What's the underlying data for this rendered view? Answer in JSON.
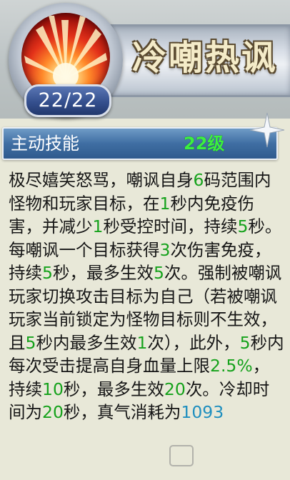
{
  "skill": {
    "name": "冷嘲热讽",
    "charges": "22/22",
    "type_label": "主动技能",
    "level": "22级"
  },
  "description": [
    {
      "t": "极尽嬉笑怒骂，嘲讽自身",
      "c": ""
    },
    {
      "t": "6",
      "c": "hl"
    },
    {
      "t": "码范围内怪物和玩家目标，在",
      "c": ""
    },
    {
      "t": "1",
      "c": "hl"
    },
    {
      "t": "秒内免疫伤害，并减少",
      "c": ""
    },
    {
      "t": "1",
      "c": "hl"
    },
    {
      "t": "秒受控时间，持续",
      "c": ""
    },
    {
      "t": "5",
      "c": "hl"
    },
    {
      "t": "秒。每嘲讽一个目标获得",
      "c": ""
    },
    {
      "t": "3",
      "c": "hl"
    },
    {
      "t": "次伤害免疫，持续",
      "c": ""
    },
    {
      "t": "5",
      "c": "hl"
    },
    {
      "t": "秒，最多生效",
      "c": ""
    },
    {
      "t": "5",
      "c": "hl"
    },
    {
      "t": "次。强制被嘲讽玩家切换攻击目标为自己（若被嘲讽玩家当前锁定为怪物目标则不生效，且",
      "c": ""
    },
    {
      "t": "5",
      "c": "hl"
    },
    {
      "t": "秒内最多生效",
      "c": ""
    },
    {
      "t": "1",
      "c": "hl"
    },
    {
      "t": "次），此外，",
      "c": ""
    },
    {
      "t": "5",
      "c": "hl"
    },
    {
      "t": "秒内每次受击提高自身血量上限",
      "c": ""
    },
    {
      "t": "2.5%",
      "c": "hl"
    },
    {
      "t": "，持续",
      "c": ""
    },
    {
      "t": "10",
      "c": "hl"
    },
    {
      "t": "秒，最多生效",
      "c": ""
    },
    {
      "t": "20",
      "c": "hl"
    },
    {
      "t": "次。冷却时间为",
      "c": ""
    },
    {
      "t": "20",
      "c": "hl"
    },
    {
      "t": "秒，真气消耗为",
      "c": ""
    },
    {
      "t": "1093",
      "c": "hl-blue"
    }
  ],
  "colors": {
    "highlight_green": "#16a21c",
    "highlight_blue": "#1f8fbf",
    "level_green": "#3cf040",
    "bar_blue": "#3f6ea3"
  },
  "icons": {
    "skill_icon": "red-burst-icon",
    "corner_decoration": "sparkle-icon"
  }
}
